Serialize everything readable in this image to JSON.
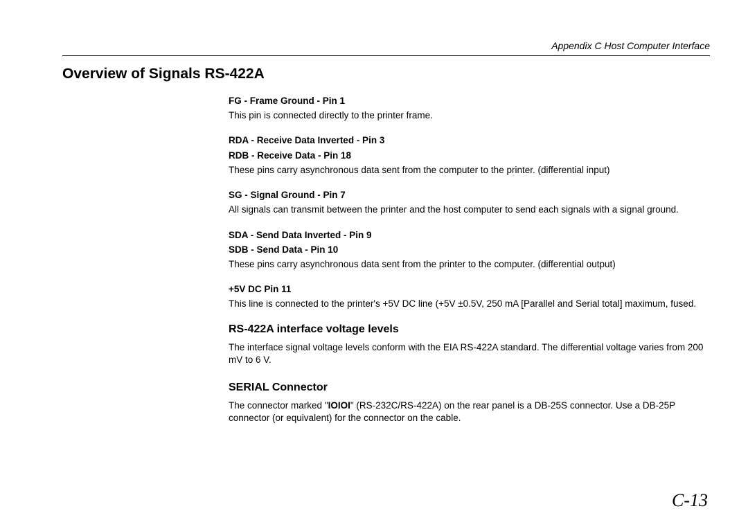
{
  "header": {
    "appendix": "Appendix C",
    "title": "  Host Computer Interface"
  },
  "main_heading": "Overview of Signals RS-422A",
  "signals": {
    "fg": {
      "heading": "FG - Frame Ground - Pin 1",
      "desc": "This pin is connected directly to the printer frame."
    },
    "rda": {
      "heading1": "RDA - Receive Data Inverted - Pin 3",
      "heading2": "RDB - Receive Data - Pin 18",
      "desc": "These pins carry asynchronous data sent from the computer to the printer. (differential input)"
    },
    "sg": {
      "heading": "SG - Signal Ground - Pin 7",
      "desc": "All signals can transmit between the printer and the host computer to send each signals with a signal ground."
    },
    "sda": {
      "heading1": "SDA - Send Data Inverted - Pin 9",
      "heading2": "SDB - Send Data - Pin 10",
      "desc": "These pins carry asynchronous data sent from the printer to the computer. (differential output)"
    },
    "v5": {
      "heading": "+5V DC Pin 11",
      "desc": "This line is connected to the printer's +5V DC line (+5V ±0.5V, 250 mA [Parallel and Serial total] maximum, fused."
    }
  },
  "voltage": {
    "heading": "RS-422A interface voltage levels",
    "desc": "The interface signal voltage levels conform with the EIA RS-422A standard. The differential voltage varies from 200 mV to 6 V."
  },
  "serial": {
    "heading": "SERIAL Connector",
    "desc_pre": "The connector marked \"",
    "desc_bold": "IOIOI",
    "desc_post": "\" (RS-232C/RS-422A) on the rear panel is a DB-25S connector. Use a DB-25P connector (or equivalent) for the connector on the cable."
  },
  "page_number": "C-13"
}
